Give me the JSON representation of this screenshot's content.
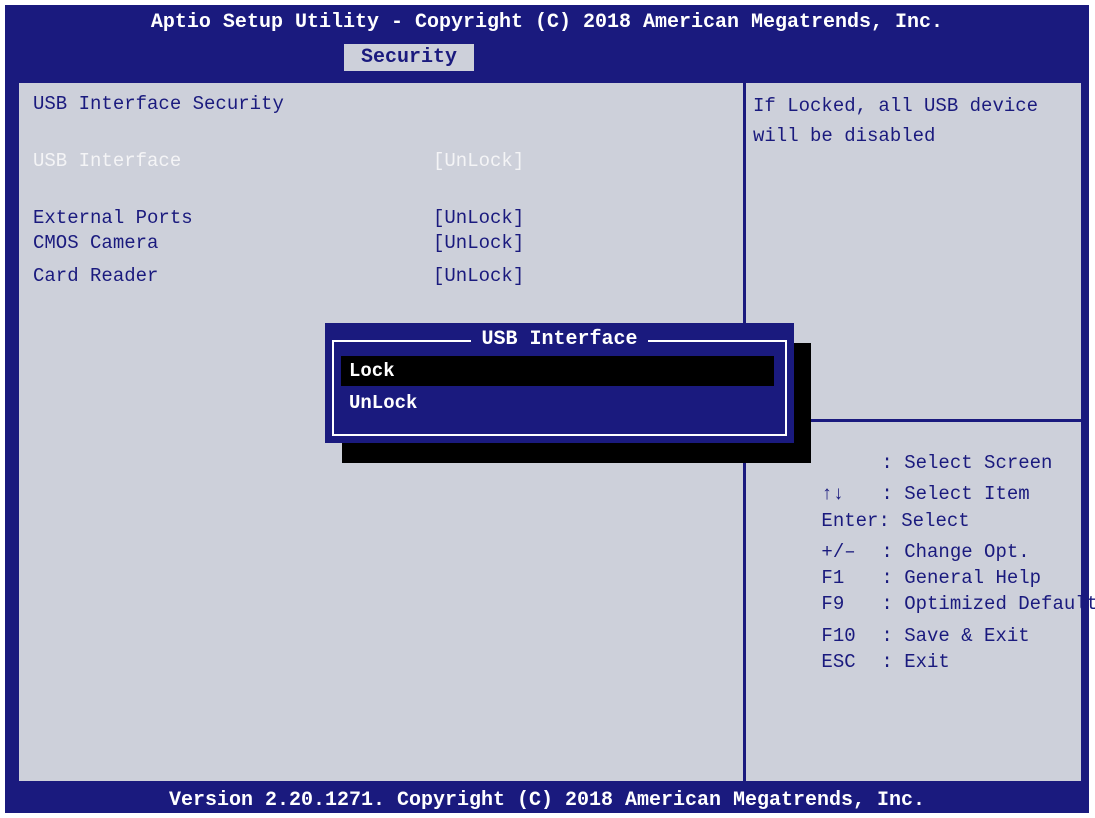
{
  "header": {
    "title": "Aptio Setup Utility - Copyright (C) 2018 American Megatrends, Inc.",
    "tab": "Security"
  },
  "left": {
    "section_title": "USB Interface Security",
    "items": [
      {
        "label": "USB Interface",
        "value": "[UnLock]"
      },
      {
        "label": "External Ports",
        "value": "[UnLock]"
      },
      {
        "label": "CMOS Camera",
        "value": "[UnLock]"
      },
      {
        "label": "Card Reader",
        "value": "[UnLock]"
      }
    ]
  },
  "help": {
    "description": "If Locked, all USB device will be disabled",
    "keys": [
      {
        "key": "",
        "desc": ": Select Screen"
      },
      {
        "key": "↑↓",
        "desc": ": Select Item"
      },
      {
        "key": "Enter",
        "desc": ": Select"
      },
      {
        "key": "+/–",
        "desc": ": Change Opt."
      },
      {
        "key": "F1",
        "desc": ": General Help"
      },
      {
        "key": "F9",
        "desc": ": Optimized Defaults"
      },
      {
        "key": "F10",
        "desc": ": Save & Exit"
      },
      {
        "key": "ESC",
        "desc": ": Exit"
      }
    ]
  },
  "popup": {
    "title": "USB Interface",
    "options": [
      "Lock",
      "UnLock"
    ],
    "selected": "Lock"
  },
  "footer": {
    "text": "Version 2.20.1271. Copyright (C) 2018 American Megatrends, Inc."
  },
  "colors": {
    "bios_blue": "#1a1a7e",
    "panel_gray": "#cdd0da",
    "highlight_white": "#ffffff",
    "selection_black": "#000000"
  }
}
